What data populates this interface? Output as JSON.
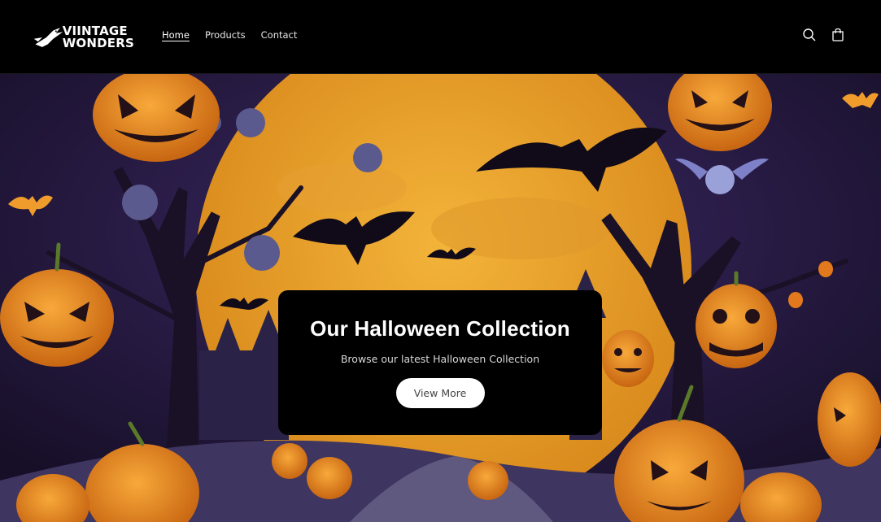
{
  "brand": {
    "line1": "VIINTAGE",
    "line2": "WONDERS"
  },
  "nav": {
    "items": [
      {
        "label": "Home",
        "active": true
      },
      {
        "label": "Products",
        "active": false
      },
      {
        "label": "Contact",
        "active": false
      }
    ]
  },
  "header_icons": [
    "search-icon",
    "cart-icon"
  ],
  "hero": {
    "title": "Our Halloween Collection",
    "subtitle": "Browse our latest Halloween Collection",
    "button_label": "View More"
  },
  "colors": {
    "header_bg": "#000000",
    "moon": "#e8a72b",
    "night": "#2a1c45",
    "pumpkin": "#f0922a",
    "card_bg": "#000000",
    "button_bg": "#ffffff"
  }
}
